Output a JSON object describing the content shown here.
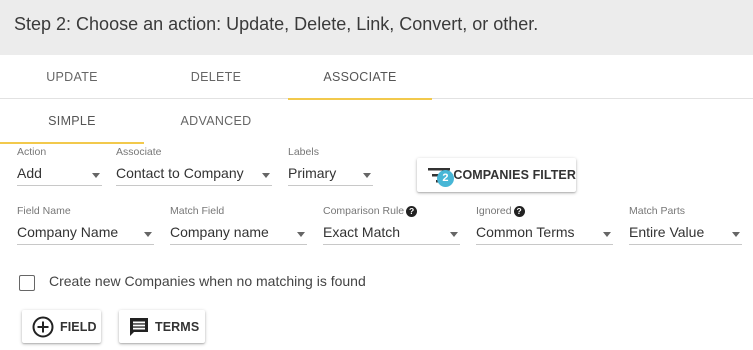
{
  "header": {
    "title": "Step 2: Choose an action: Update, Delete, Link, Convert, or other."
  },
  "main_tabs": [
    {
      "label": "UPDATE",
      "active": false
    },
    {
      "label": "DELETE",
      "active": false
    },
    {
      "label": "ASSOCIATE",
      "active": true
    }
  ],
  "sub_tabs": [
    {
      "label": "SIMPLE",
      "active": true
    },
    {
      "label": "ADVANCED",
      "active": false
    }
  ],
  "row1": {
    "action": {
      "label": "Action",
      "value": "Add"
    },
    "associate": {
      "label": "Associate",
      "value": "Contact to Company"
    },
    "labels": {
      "label": "Labels",
      "value": "Primary"
    },
    "filter_button": {
      "label": "COMPANIES FILTER",
      "badge": "2",
      "icon": "filter-list-icon"
    }
  },
  "row2": {
    "field_name": {
      "label": "Field Name",
      "value": "Company Name"
    },
    "match_field": {
      "label": "Match Field",
      "value": "Company name"
    },
    "comparison_rule": {
      "label": "Comparison Rule",
      "value": "Exact Match",
      "help": "?"
    },
    "ignored": {
      "label": "Ignored",
      "value": "Common Terms",
      "help": "?"
    },
    "match_parts": {
      "label": "Match Parts",
      "value": "Entire Value"
    }
  },
  "create_new": {
    "label": "Create new Companies when no matching is found",
    "checked": false
  },
  "buttons": {
    "field": {
      "label": "FIELD",
      "icon": "add-circle-icon"
    },
    "terms": {
      "label": "TERMS",
      "icon": "comment-icon"
    }
  },
  "colors": {
    "accent": "#f2c94c",
    "badge": "#47b6d6",
    "header_bg": "#ececec"
  }
}
